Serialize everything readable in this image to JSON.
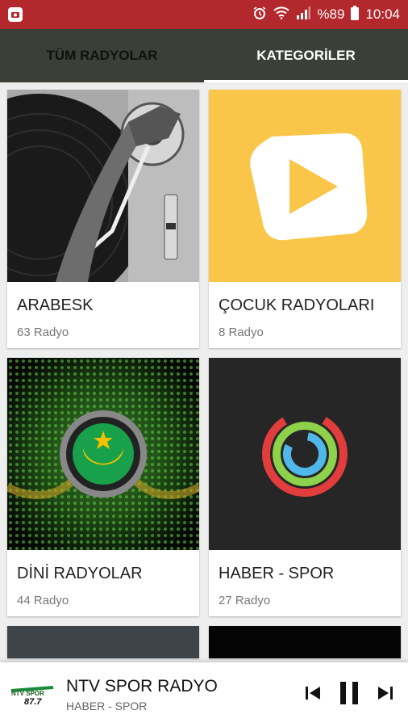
{
  "status": {
    "battery": "%89",
    "time": "10:04"
  },
  "tabs": [
    {
      "label": "TÜM RADYOLAR"
    },
    {
      "label": "KATEGORİLER"
    }
  ],
  "categories": [
    {
      "title": "ARABESK",
      "count": "63 Radyo"
    },
    {
      "title": "ÇOCUK RADYOLARI",
      "count": "8 Radyo"
    },
    {
      "title": "DİNİ RADYOLAR",
      "count": "44 Radyo"
    },
    {
      "title": "HABER - SPOR",
      "count": "27 Radyo"
    }
  ],
  "player": {
    "logo_text": "NTV SPOR 87.7",
    "station": "NTV SPOR RADYO",
    "category": "HABER - SPOR",
    "icons": {
      "prev": "skip-previous-icon",
      "pause": "pause-icon",
      "next": "skip-next-icon"
    }
  },
  "colors": {
    "status_bar": "#b3282d",
    "tab_bar": "#3a3f37",
    "yellow": "#f9c64a",
    "dark": "#262626"
  }
}
